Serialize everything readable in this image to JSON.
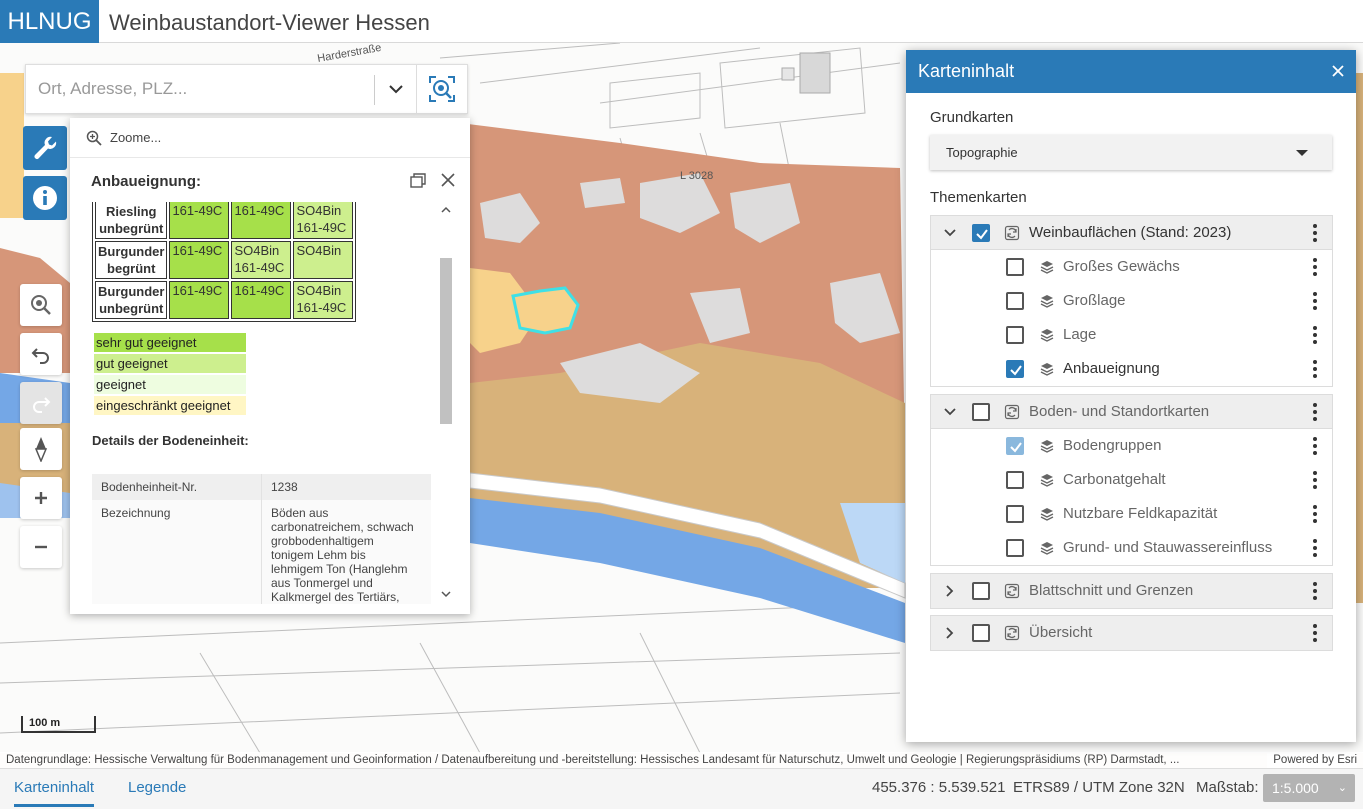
{
  "header": {
    "logo": "HLNUG",
    "title": "Weinbaustandort-Viewer Hessen"
  },
  "map": {
    "street_labels": [
      "Harderstraße",
      "L 3028"
    ],
    "scale_label": "100 m",
    "selection_color": "#3fe0e6"
  },
  "search": {
    "placeholder": "Ort, Adresse, PLZ..."
  },
  "popup": {
    "zoom_label": "Zoome...",
    "title": "Anbaueignung:",
    "table_rows": [
      {
        "head": [
          "Riesling",
          "unbegrünt"
        ],
        "cells": [
          [
            "161-49C"
          ],
          [
            "161-49C"
          ],
          [
            "SO4Bin",
            "161-49C"
          ]
        ],
        "classes": [
          "vg",
          "vg",
          "gg"
        ]
      },
      {
        "head": [
          "Burgunder",
          "begrünt"
        ],
        "cells": [
          [
            "161-49C"
          ],
          [
            "SO4Bin",
            "161-49C"
          ],
          [
            "SO4Bin"
          ]
        ],
        "classes": [
          "vg",
          "gg",
          "gg"
        ]
      },
      {
        "head": [
          "Burgunder",
          "unbegrünt"
        ],
        "cells": [
          [
            "161-49C"
          ],
          [
            "161-49C"
          ],
          [
            "SO4Bin",
            "161-49C"
          ]
        ],
        "classes": [
          "vg",
          "vg",
          "gg"
        ]
      }
    ],
    "legend": [
      {
        "label": "sehr gut geeignet",
        "color": "#a6e04a"
      },
      {
        "label": "gut geeignet",
        "color": "#cdef8e"
      },
      {
        "label": "geeignet",
        "color": "#eefde0"
      },
      {
        "label": "eingeschränkt geeignet",
        "color": "#fff6c4"
      }
    ],
    "details_title": "Details der Bodeneinheit:",
    "details": {
      "nr_label": "Bodenheinheit-Nr.",
      "nr_value": "1238",
      "bez_label": "Bezeichnung",
      "bez_value_lines": [
        "Böden aus",
        "carbonatreichem, schwach",
        "grobbodenhaltigem",
        "tonigem Lehm bis",
        "lehmigem Ton (Hanglehm",
        "aus Tonmergel und",
        "Kalkmergel des Tertiärs,"
      ]
    }
  },
  "attribution": {
    "text": "Datengrundlage: Hessische Verwaltung für Bodenmanagement und Geoinformation / Datenaufbereitung und -bereitstellung: Hessisches Landesamt für Naturschutz, Umwelt und Geologie | Regierungspräsidiums (RP) Darmstadt, ...",
    "powered": "Powered by Esri"
  },
  "footer": {
    "tabs": [
      "Karteninhalt",
      "Legende"
    ],
    "active_tab": "Karteninhalt",
    "coords": "455.376 : 5.539.521",
    "crs": "ETRS89 / UTM Zone 32N",
    "scale_label": "Maßstab:",
    "scale_value": "1:5.000"
  },
  "panel": {
    "title": "Karteninhalt",
    "basemaps_label": "Grundkarten",
    "basemap_selected": "Topographie",
    "themes_label": "Themenkarten",
    "groups": [
      {
        "name": "Weinbauflächen (Stand: 2023)",
        "expanded": true,
        "checked": true,
        "layers": [
          {
            "name": "Großes Gewächs",
            "checked": false
          },
          {
            "name": "Großlage",
            "checked": false
          },
          {
            "name": "Lage",
            "checked": false
          },
          {
            "name": "Anbaueignung",
            "checked": true
          }
        ]
      },
      {
        "name": "Boden- und Standortkarten",
        "expanded": true,
        "checked": false,
        "layers": [
          {
            "name": "Bodengruppen",
            "checked": true
          },
          {
            "name": "Carbonatgehalt",
            "checked": false
          },
          {
            "name": "Nutzbare Feldkapazität",
            "checked": false
          },
          {
            "name": "Grund- und Stauwassereinfluss",
            "checked": false
          }
        ]
      },
      {
        "name": "Blattschnitt und Grenzen",
        "expanded": false,
        "checked": false,
        "layers": []
      },
      {
        "name": "Übersicht",
        "expanded": false,
        "checked": false,
        "layers": []
      }
    ]
  },
  "colors": {
    "accent": "#2a7ab7",
    "soil_red": "#d69679",
    "soil_tan": "#d8b27a",
    "soil_yellow": "#f7d28b",
    "water_blue": "#74a7e6",
    "grey_area": "#dddcdc"
  }
}
